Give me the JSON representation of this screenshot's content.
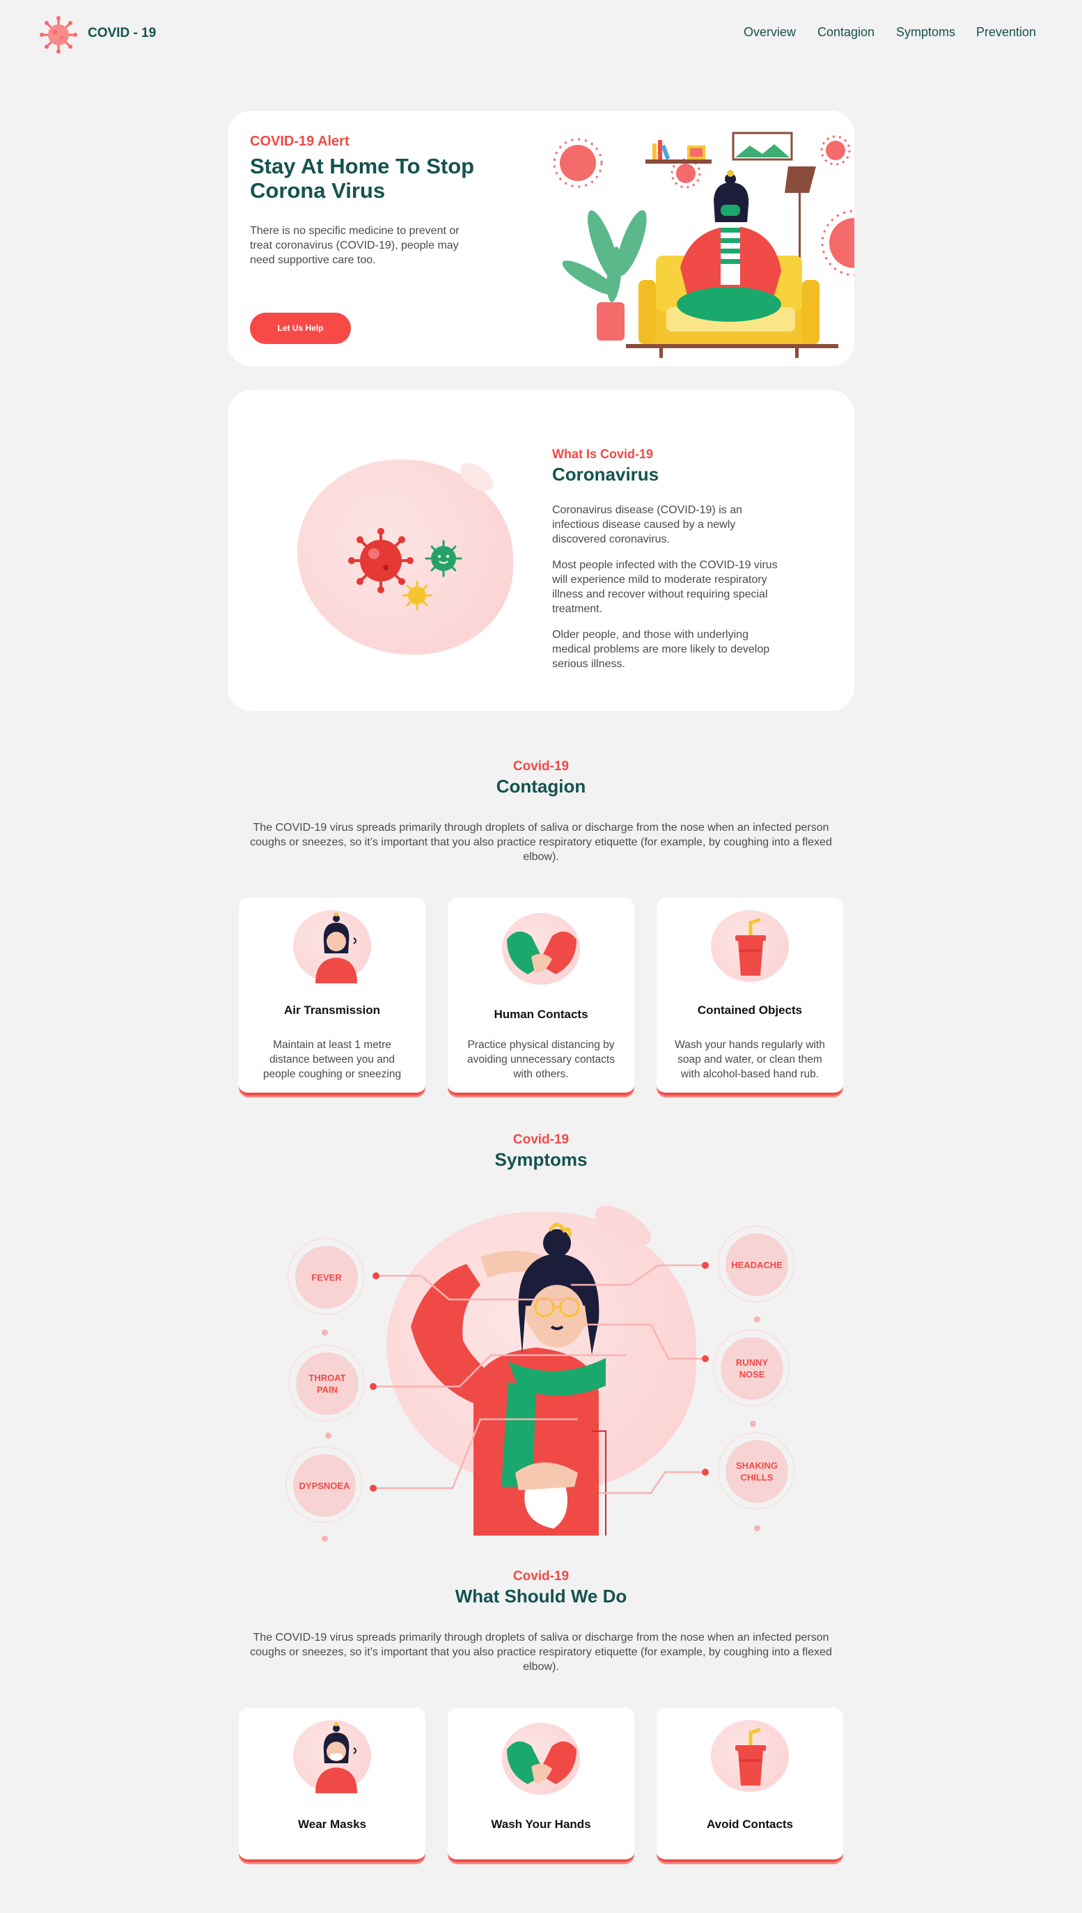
{
  "nav": {
    "logo": "COVID - 19",
    "links": [
      "Overview",
      "Contagion",
      "Symptoms",
      "Prevention"
    ]
  },
  "hero": {
    "eyebrow": "COVID-19 Alert",
    "title_line1": "Stay At Home To Stop",
    "title_line2": "Corona Virus",
    "text": "There is no specific medicine to prevent or treat coronavirus (COVID-19), people may need supportive care too.",
    "button": "Let Us Help"
  },
  "about": {
    "eyebrow": "What Is Covid-19",
    "title": "Coronavirus",
    "p1": "Coronavirus disease (COVID-19) is an infectious disease caused by a newly discovered coronavirus.",
    "p2": "Most people infected with the COVID-19 virus will experience mild to moderate respiratory illness and recover without requiring special treatment.",
    "p3": "Older people, and those with underlying medical problems are more likely to develop serious illness."
  },
  "contagion": {
    "eyebrow": "Covid-19",
    "title": "Contagion",
    "text": "The COVID-19 virus spreads primarily through droplets of saliva or discharge from the nose when an infected person coughs or sneezes, so it’s important that you also practice respiratory etiquette (for example, by coughing into a flexed elbow).",
    "cards": [
      {
        "title": "Air Transmission",
        "text": "Maintain at least 1 metre distance between you and people coughing or sneezing"
      },
      {
        "title": "Human Contacts",
        "text": "Practice physical distancing by avoiding unnecessary contacts with others."
      },
      {
        "title": "Contained Objects",
        "text": "Wash your hands regularly with soap and water, or clean them with alcohol-based hand rub."
      }
    ]
  },
  "symptoms": {
    "eyebrow": "Covid-19",
    "title": "Symptoms",
    "left": [
      "FEVER",
      "THROAT PAIN",
      "DYPSNOEA"
    ],
    "right": [
      "HEADACHE",
      "RUNNY NOSE",
      "SHAKING CHILLS"
    ]
  },
  "prevention": {
    "eyebrow": "Covid-19",
    "title": "What Should We Do",
    "text": "The COVID-19 virus spreads primarily through droplets of saliva or discharge from the nose when an infected person coughs or sneezes, so it’s important that you also practice respiratory etiquette (for example, by coughing into a flexed elbow).",
    "cards": [
      {
        "title": "Wear Masks"
      },
      {
        "title": "Wash Your Hands"
      },
      {
        "title": "Avoid Contacts"
      }
    ]
  },
  "colors": {
    "accent": "#f04a46",
    "brand": "#14524f",
    "background": "#f2f2f2"
  },
  "icons": [
    "virus-logo-icon",
    "virus-icon",
    "woman-coughing-icon",
    "handshake-icon",
    "cup-icon"
  ]
}
